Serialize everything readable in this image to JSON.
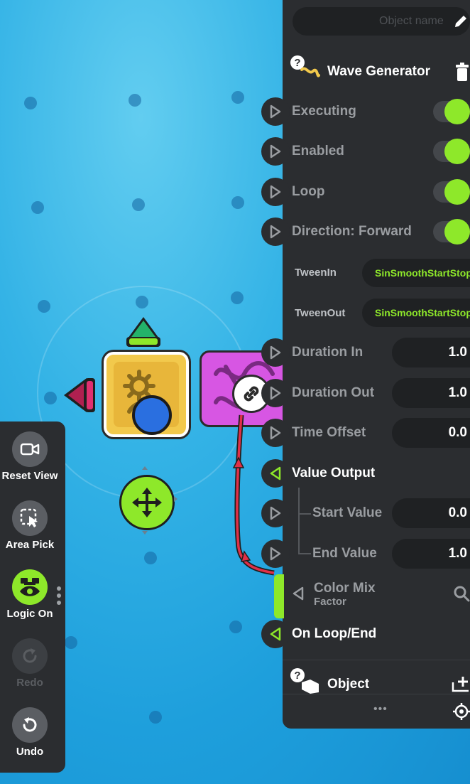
{
  "toolbar": {
    "items": [
      {
        "label": "Reset View",
        "icon": "camera-icon",
        "state": "normal"
      },
      {
        "label": "Area Pick",
        "icon": "area-pick-icon",
        "state": "normal"
      },
      {
        "label": "Logic On",
        "icon": "logic-eye-icon",
        "state": "active"
      },
      {
        "label": "Redo",
        "icon": "redo-icon",
        "state": "disabled"
      },
      {
        "label": "Undo",
        "icon": "undo-icon",
        "state": "normal"
      }
    ]
  },
  "panel": {
    "name_placeholder": "Object name",
    "title": "Wave Generator",
    "rows": {
      "executing": "Executing",
      "enabled": "Enabled",
      "loop": "Loop",
      "direction": "Direction: Forward",
      "tween_in_label": "TweenIn",
      "tween_in_value": "SinSmoothStartStop",
      "tween_out_label": "TweenOut",
      "tween_out_value": "SinSmoothStartStop",
      "duration_in_label": "Duration In",
      "duration_in_value": "1.0",
      "duration_out_label": "Duration Out",
      "duration_out_value": "1.0",
      "time_offset_label": "Time Offset",
      "time_offset_value": "0.0",
      "value_output": "Value Output",
      "start_value_label": "Start Value",
      "start_value_value": "0.0",
      "end_value_label": "End Value",
      "end_value_value": "1.0",
      "color_mix": "Color Mix",
      "color_mix_sub": "Factor",
      "on_loop_end": "On Loop/End",
      "object": "Object"
    },
    "more": "•••"
  },
  "colors": {
    "accent": "#8ee82a",
    "panel": "#2b2d30",
    "field": "#1f2123",
    "canvas": "#2aa8e0",
    "magenta_node": "#d756e3",
    "yellow_node": "#f2c94c",
    "wire": "#e03048"
  }
}
